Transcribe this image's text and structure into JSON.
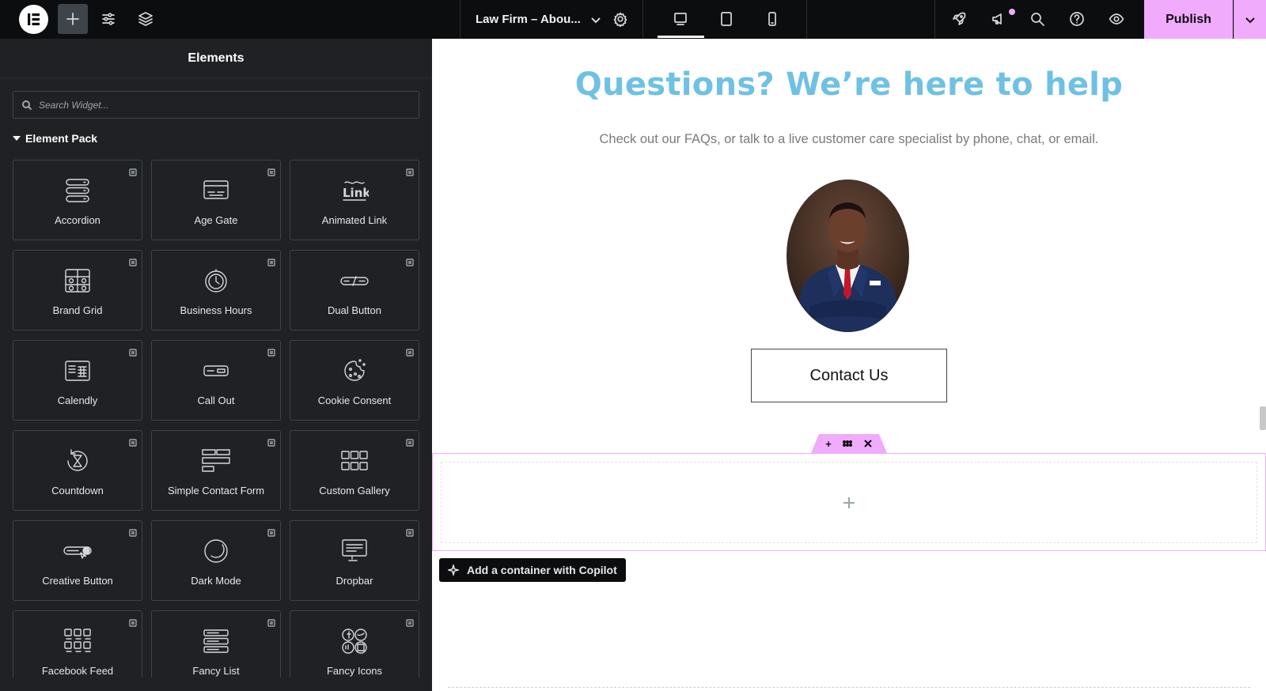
{
  "topbar": {
    "page_name": "Law Firm – Abou...",
    "publish_label": "Publish"
  },
  "panel": {
    "title": "Elements",
    "search_placeholder": "Search Widget...",
    "category": "Element Pack",
    "widgets": [
      {
        "label": "Accordion",
        "icon": "accordion-icon"
      },
      {
        "label": "Age Gate",
        "icon": "age-gate-icon"
      },
      {
        "label": "Animated Link",
        "icon": "animated-link-icon"
      },
      {
        "label": "Brand Grid",
        "icon": "brand-grid-icon"
      },
      {
        "label": "Business Hours",
        "icon": "clock-icon"
      },
      {
        "label": "Dual Button",
        "icon": "dual-button-icon"
      },
      {
        "label": "Calendly",
        "icon": "calendly-icon"
      },
      {
        "label": "Call Out",
        "icon": "call-out-icon"
      },
      {
        "label": "Cookie Consent",
        "icon": "cookie-icon"
      },
      {
        "label": "Countdown",
        "icon": "hourglass-icon"
      },
      {
        "label": "Simple Contact Form",
        "icon": "contact-form-icon"
      },
      {
        "label": "Custom Gallery",
        "icon": "gallery-icon"
      },
      {
        "label": "Creative Button",
        "icon": "creative-button-icon"
      },
      {
        "label": "Dark Mode",
        "icon": "moon-icon"
      },
      {
        "label": "Dropbar",
        "icon": "dropbar-icon"
      },
      {
        "label": "Facebook Feed",
        "icon": "facebook-feed-icon"
      },
      {
        "label": "Fancy List",
        "icon": "fancy-list-icon"
      },
      {
        "label": "Fancy Icons",
        "icon": "fancy-icons-icon"
      }
    ]
  },
  "canvas": {
    "headline": "Questions? We’re here to help",
    "subtext": "Check out our FAQs, or talk to a live customer care specialist by phone, chat, or email.",
    "contact_button": "Contact Us",
    "copilot_button": "Add a container with Copilot"
  },
  "colors": {
    "accent": "#f0abfc",
    "headline": "#6ec1e4",
    "panel_bg": "#1f2124",
    "topbar_bg": "#0c0d0e"
  }
}
